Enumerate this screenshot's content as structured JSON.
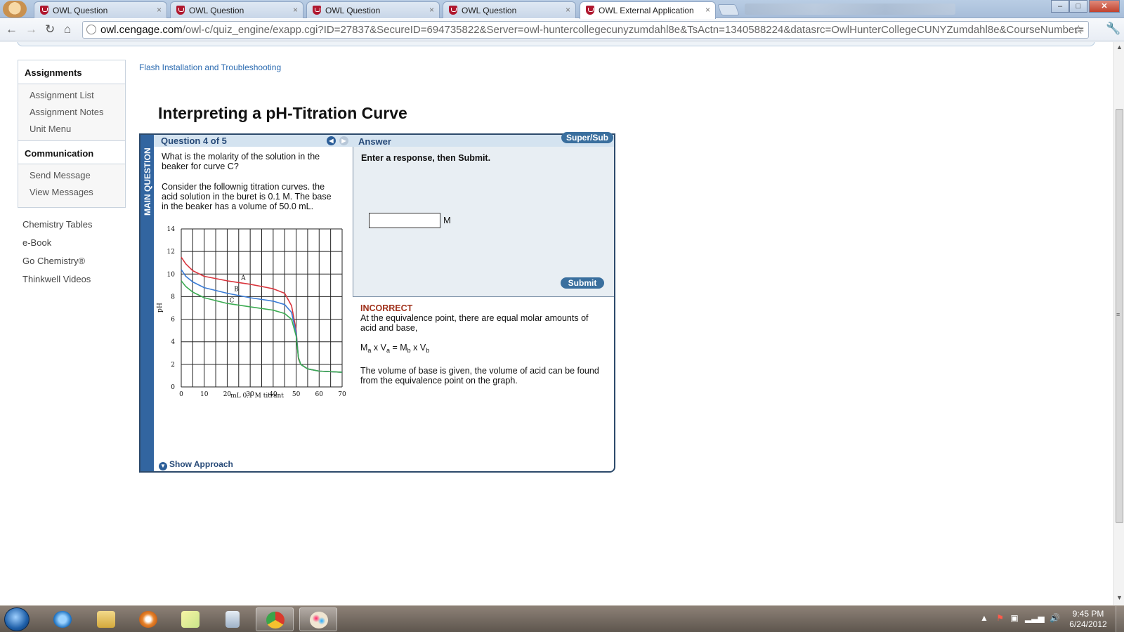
{
  "browser": {
    "tabs": [
      {
        "title": "OWL Question",
        "active": false
      },
      {
        "title": "OWL Question",
        "active": false
      },
      {
        "title": "OWL Question",
        "active": false
      },
      {
        "title": "OWL Question",
        "active": false
      },
      {
        "title": "OWL External Application",
        "active": true
      }
    ],
    "url_host": "owl.cengage.com",
    "url_path": "/owl-c/quiz_engine/exapp.cgi?ID=27837&SecureID=694735822&Server=owl-huntercollegecunyzumdahl8e&TsActn=1340588224&datasrc=OwlHunterCollegeCUNYZumdahl8e&CourseNumber="
  },
  "sidebar": {
    "assignments": {
      "heading": "Assignments",
      "items": [
        "Assignment List",
        "Assignment Notes",
        "Unit Menu"
      ]
    },
    "communication": {
      "heading": "Communication",
      "items": [
        "Send Message",
        "View Messages"
      ]
    },
    "links": [
      "Chemistry Tables",
      "e-Book",
      "Go Chemistry®",
      "Thinkwell Videos"
    ]
  },
  "page": {
    "flash_link": "Flash Installation and Troubleshooting",
    "title": "Interpreting a pH-Titration Curve"
  },
  "question": {
    "side_label": "MAIN QUESTION",
    "header": "Question 4 of 5",
    "prompt": "What is the molarity of the solution in the beaker for curve C?",
    "context": "Consider the follownig titration curves. the acid solution in the buret is 0.1 M. The base in the beaker has a volume of 50.0 mL.",
    "show_approach": "Show Approach"
  },
  "answer": {
    "header": "Answer",
    "super_sub": "Super/Sub",
    "instruction": "Enter a response, then Submit.",
    "input_value": "",
    "unit": "M",
    "submit": "Submit"
  },
  "feedback": {
    "status": "INCORRECT",
    "line1": "At the equivalence point, there are equal molar amounts of acid and base,",
    "eq_Ma": "M",
    "eq_a1": "a",
    "eq_x1": " x V",
    "eq_a2": "a",
    "eq_eq": " = M",
    "eq_b1": "b",
    "eq_x2": " x V",
    "eq_b2": "b",
    "line2": "The volume of base is given, the volume of acid can be found from the equivalence point on the graph."
  },
  "chart_data": {
    "type": "line",
    "title": "",
    "xlabel": "mL 0.1 M titrant",
    "ylabel": "pH",
    "xlim": [
      0,
      70
    ],
    "ylim": [
      0,
      14
    ],
    "xticks": [
      0,
      10,
      20,
      30,
      40,
      50,
      60,
      70
    ],
    "yticks": [
      0,
      2,
      4,
      6,
      8,
      10,
      12,
      14
    ],
    "grid": true,
    "series": [
      {
        "name": "A",
        "color": "#d9363e",
        "x": [
          0,
          2,
          5,
          10,
          20,
          30,
          40,
          45,
          48,
          50,
          51,
          52,
          55,
          60,
          70
        ],
        "y": [
          11.5,
          10.9,
          10.3,
          9.8,
          9.4,
          9.1,
          8.7,
          8.3,
          7.2,
          5.0,
          2.5,
          2.0,
          1.6,
          1.4,
          1.3
        ]
      },
      {
        "name": "B",
        "color": "#3a7bd5",
        "x": [
          0,
          2,
          5,
          10,
          20,
          30,
          40,
          45,
          48,
          50,
          51,
          52,
          55,
          60,
          70
        ],
        "y": [
          10.4,
          9.8,
          9.3,
          8.8,
          8.3,
          7.9,
          7.6,
          7.3,
          6.6,
          4.8,
          2.6,
          2.0,
          1.6,
          1.4,
          1.3
        ]
      },
      {
        "name": "C",
        "color": "#3cab52",
        "x": [
          0,
          2,
          5,
          10,
          20,
          30,
          40,
          45,
          48,
          50,
          51,
          52,
          55,
          60,
          70
        ],
        "y": [
          9.4,
          8.9,
          8.4,
          7.9,
          7.4,
          7.1,
          6.8,
          6.5,
          6.0,
          4.5,
          2.6,
          2.0,
          1.6,
          1.4,
          1.3
        ]
      }
    ],
    "annotations": [
      {
        "text": "A",
        "x": 27,
        "y": 9.5
      },
      {
        "text": "B",
        "x": 24,
        "y": 8.5
      },
      {
        "text": "C",
        "x": 22,
        "y": 7.5
      }
    ]
  },
  "taskbar": {
    "clock_time": "9:45 PM",
    "clock_date": "6/24/2012"
  },
  "colors": {
    "accent": "#3265a0",
    "incorrect": "#a0321c",
    "button": "#3a6f9e"
  }
}
